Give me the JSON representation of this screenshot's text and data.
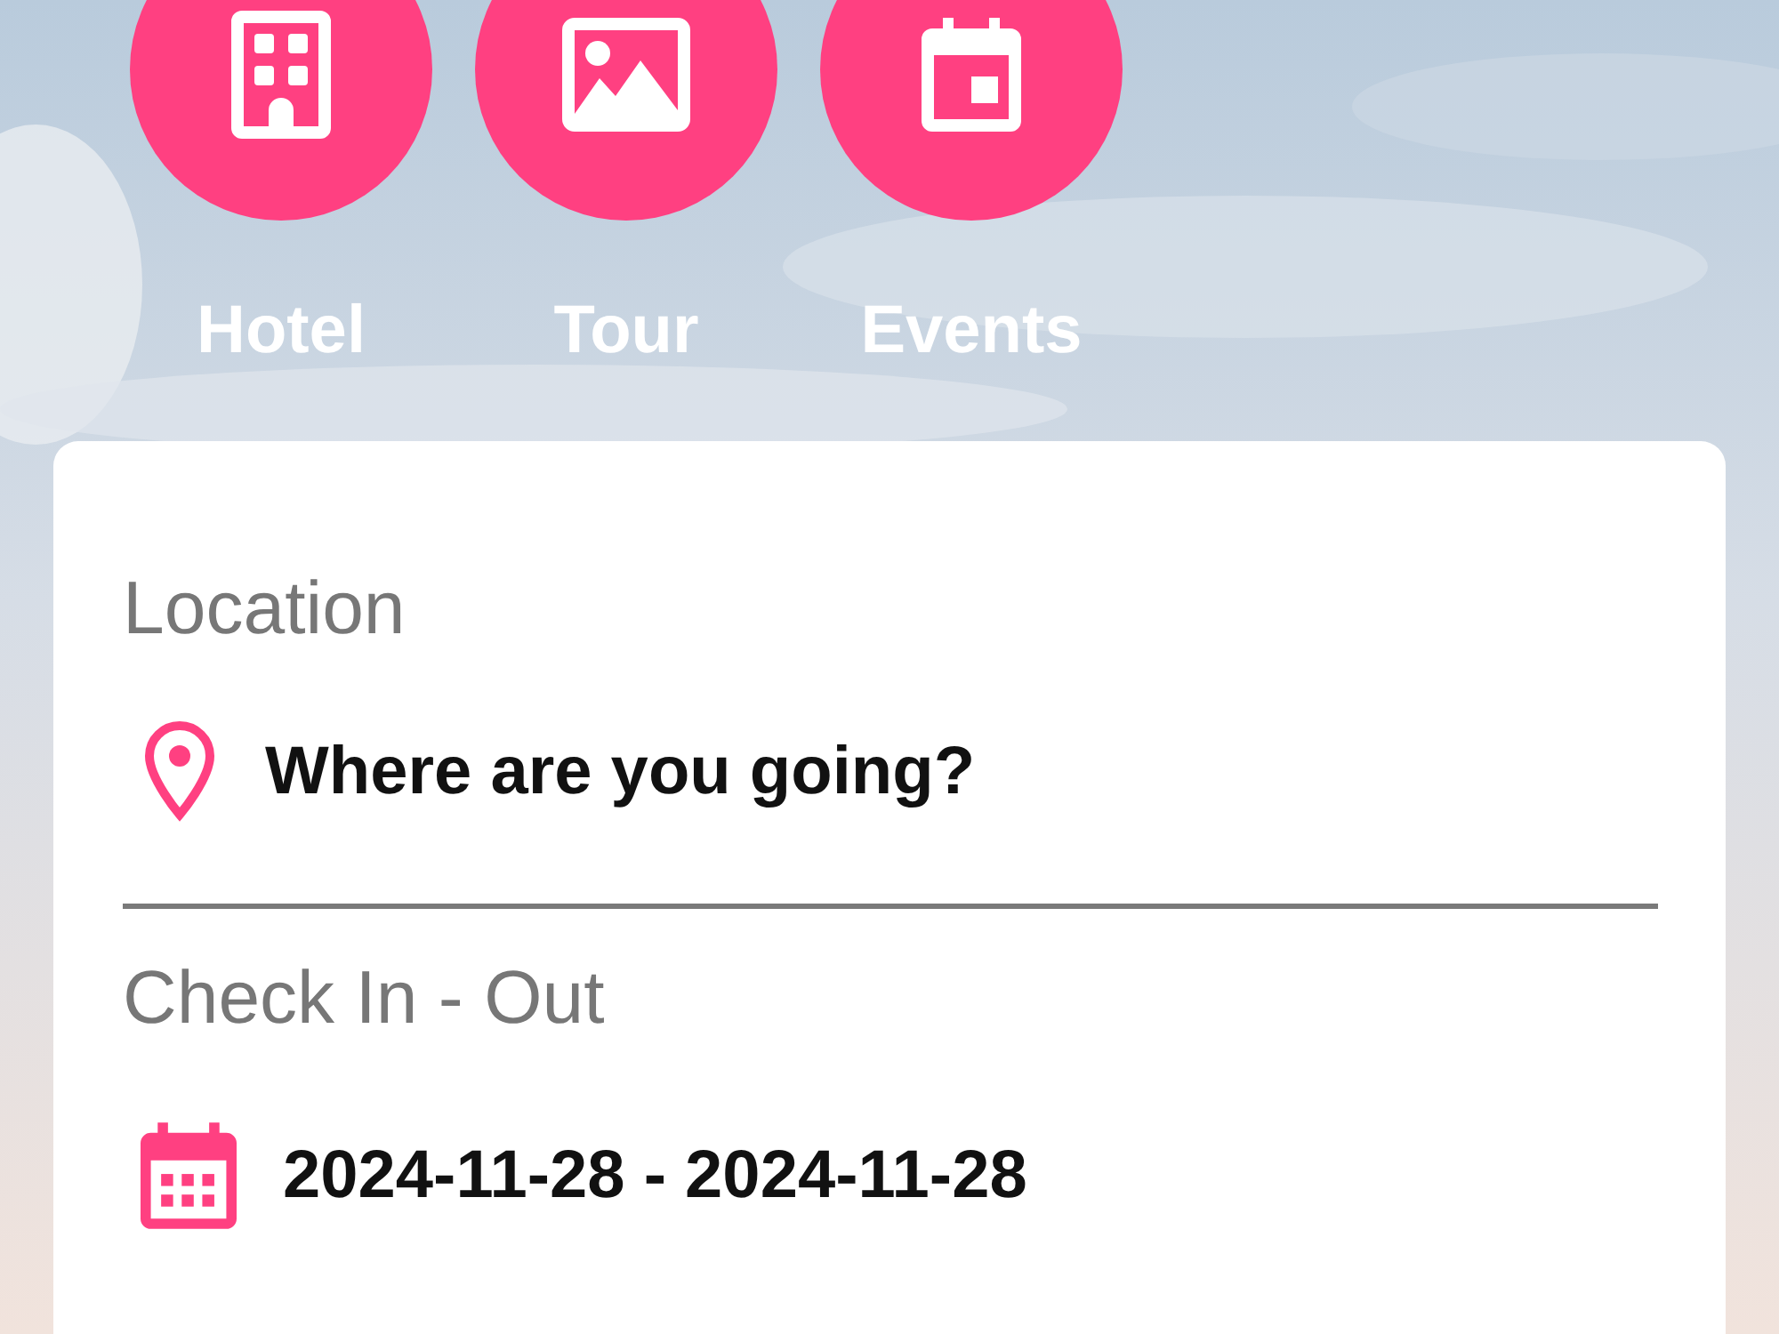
{
  "categories": [
    {
      "kind": "hotel",
      "label": "Hotel"
    },
    {
      "kind": "tour",
      "label": "Tour"
    },
    {
      "kind": "events",
      "label": "Events"
    }
  ],
  "search_card": {
    "fields": [
      {
        "kind": "location",
        "label": "Location",
        "value": "Where are you going?"
      },
      {
        "kind": "dates",
        "label": "Check In - Out",
        "value": "2024-11-28 - 2024-11-28"
      }
    ]
  }
}
